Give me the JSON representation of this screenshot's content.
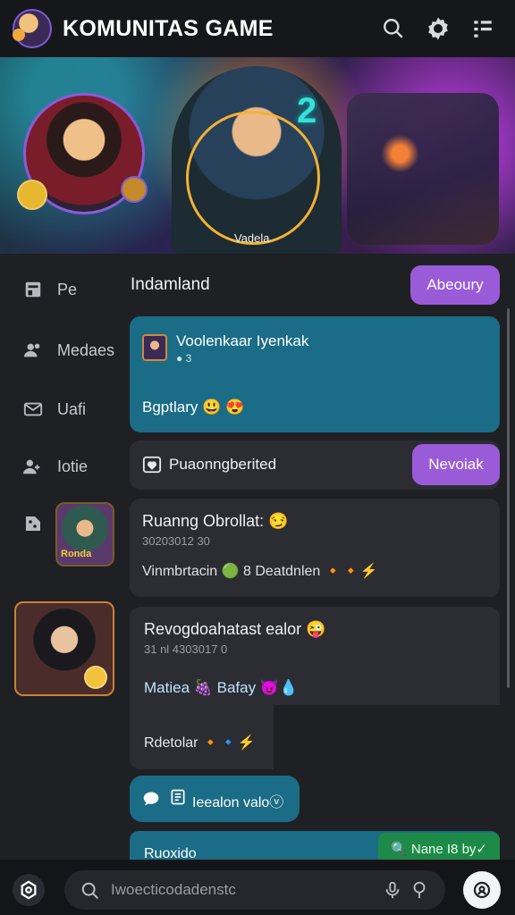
{
  "header": {
    "title": "KOMUNITAS GAME",
    "icons": [
      "search-icon",
      "settings-icon",
      "menu-icon"
    ]
  },
  "banner": {
    "number": "2",
    "caption": "Vadela"
  },
  "sidebar": {
    "items": [
      {
        "label": "Pe",
        "icon": "home-icon"
      },
      {
        "label": "Medaes",
        "icon": "users-icon"
      },
      {
        "label": "Uafi",
        "icon": "mail-icon"
      },
      {
        "label": "Iotie",
        "icon": "friends-icon"
      }
    ],
    "thumb_label": "Ronda"
  },
  "main": {
    "title": "Indamland",
    "about_button": "Abeoury",
    "card_teal": {
      "name": "Voolenkaar Iyenkak",
      "meta": "● 3",
      "body": "Bgptlary 😃 😍"
    },
    "card_plain": {
      "text": "Puaonngberited",
      "button": "Nevoiak"
    },
    "msg1": {
      "title": "Ruanng Obrollat: 😏",
      "meta": "30203012 30",
      "body": "Vinmbrtacin  🟢  8 Deatdnlen 🔸🔸⚡"
    },
    "msg2": {
      "title": "Revogdoahatast ealor 😜",
      "meta": "31 nl 4303017 0",
      "line1": "Matiea 🍇 Bafay 😈💧",
      "line2": "Rdetolar 🔸🔹⚡"
    },
    "bubble": {
      "text": "Ieealon valoⓥ"
    },
    "bottom_card": {
      "text": "Ruoxido"
    },
    "green_tag": "🔍 Nane I8 by✓"
  },
  "bottombar": {
    "search_placeholder": "Iwoecticodadenstc"
  },
  "colors": {
    "accent_purple": "#9a5bd9",
    "teal_card": "#1b6c86",
    "green_tag": "#1e8a4a",
    "background": "#1f2024"
  }
}
